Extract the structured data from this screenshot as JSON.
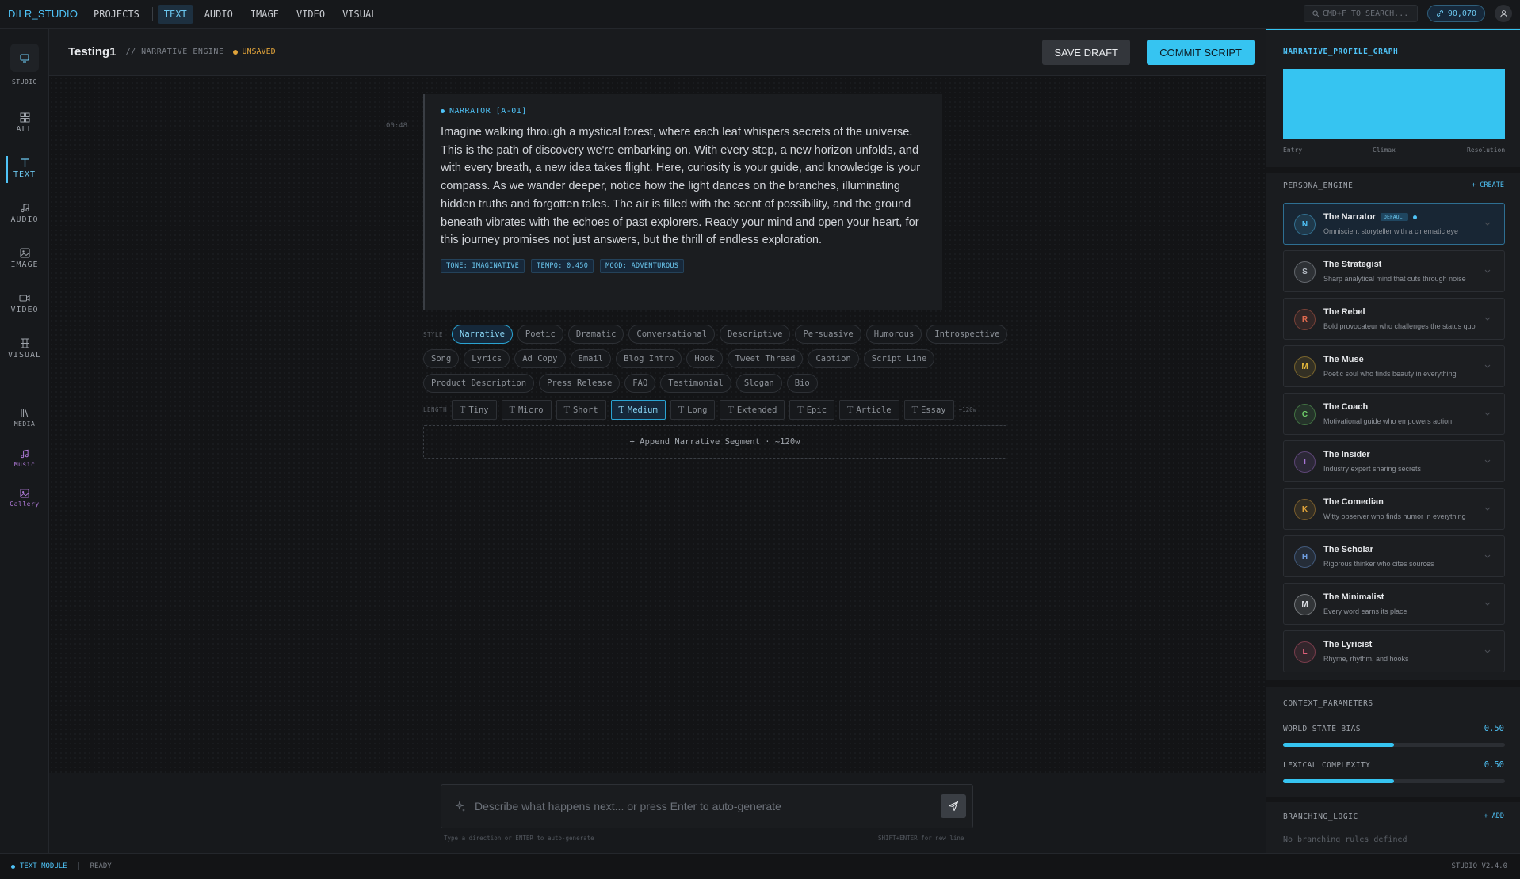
{
  "topbar": {
    "brand": "DILR_STUDIO",
    "nav": [
      "PROJECTS",
      "TEXT",
      "AUDIO",
      "IMAGE",
      "VIDEO",
      "VISUAL"
    ],
    "active_nav": "TEXT",
    "search_placeholder": "CMD+F TO SEARCH...",
    "credits": "90,070"
  },
  "rail": {
    "studio": "STUDIO",
    "all": "ALL",
    "text": "TEXT",
    "audio": "AUDIO",
    "image": "IMAGE",
    "video": "VIDEO",
    "visual": "VISUAL",
    "media": "MEDIA",
    "music": "Music",
    "gallery": "Gallery"
  },
  "header": {
    "title": "Testing1",
    "subtitle": "// NARRATIVE ENGINE",
    "status": "UNSAVED",
    "save_draft": "SAVE DRAFT",
    "commit": "COMMIT SCRIPT"
  },
  "segment": {
    "timestamp": "00:48",
    "speaker": "NARRATOR [A-01]",
    "text": "Imagine walking through a mystical forest, where each leaf whispers secrets of the universe. This is the path of discovery we're embarking on. With every step, a new horizon unfolds, and with every breath, a new idea takes flight. Here, curiosity is your guide, and knowledge is your compass. As we wander deeper, notice how the light dances on the branches, illuminating hidden truths and forgotten tales. The air is filled with the scent of possibility, and the ground beneath vibrates with the echoes of past explorers. Ready your mind and open your heart, for this journey promises not just answers, but the thrill of endless exploration.",
    "tags": [
      "TONE: IMAGINATIVE",
      "TEMPO: 0.450",
      "MOOD: ADVENTUROUS"
    ]
  },
  "style": {
    "label": "STYLE",
    "row1": [
      "Narrative",
      "Poetic",
      "Dramatic",
      "Conversational",
      "Descriptive",
      "Persuasive",
      "Humorous",
      "Introspective"
    ],
    "row2": [
      "Song",
      "Lyrics",
      "Ad Copy",
      "Email",
      "Blog Intro",
      "Hook",
      "Tweet Thread",
      "Caption",
      "Script Line"
    ],
    "row3": [
      "Product Description",
      "Press Release",
      "FAQ",
      "Testimonial",
      "Slogan",
      "Bio"
    ],
    "selected": "Narrative"
  },
  "length": {
    "label": "LENGTH",
    "options": [
      "Tiny",
      "Micro",
      "Short",
      "Medium",
      "Long",
      "Extended",
      "Epic",
      "Article",
      "Essay"
    ],
    "selected": "Medium",
    "hint": "~120w"
  },
  "append_label": "+ Append Narrative Segment · ~120w",
  "prompt": {
    "placeholder": "Describe what happens next... or press Enter to auto-generate",
    "hint_left": "Type a direction or ENTER to auto-generate",
    "hint_right": "SHIFT+ENTER for new line"
  },
  "status": {
    "module": "TEXT MODULE",
    "state": "READY",
    "version": "STUDIO V2.4.0"
  },
  "right_panel": {
    "graph_title": "NARRATIVE_PROFILE_GRAPH",
    "graph_labels": [
      "Entry",
      "Climax",
      "Resolution"
    ],
    "persona_title": "PERSONA_ENGINE",
    "create": "+ CREATE",
    "personas": [
      {
        "initial": "N",
        "name": "The Narrator",
        "desc": "Omniscient storyteller with a cinematic eye",
        "badge": "DEFAULT",
        "color": "#4fc3f7"
      },
      {
        "initial": "S",
        "name": "The Strategist",
        "desc": "Sharp analytical mind that cuts through noise",
        "color": "#b5bbc3"
      },
      {
        "initial": "R",
        "name": "The Rebel",
        "desc": "Bold provocateur who challenges the status quo",
        "color": "#e06a4f"
      },
      {
        "initial": "M",
        "name": "The Muse",
        "desc": "Poetic soul who finds beauty in everything",
        "color": "#e0b53a"
      },
      {
        "initial": "C",
        "name": "The Coach",
        "desc": "Motivational guide who empowers action",
        "color": "#6fcf6a"
      },
      {
        "initial": "I",
        "name": "The Insider",
        "desc": "Industry expert sharing secrets",
        "color": "#a874d6"
      },
      {
        "initial": "K",
        "name": "The Comedian",
        "desc": "Witty observer who finds humor in everything",
        "color": "#e0a33a"
      },
      {
        "initial": "H",
        "name": "The Scholar",
        "desc": "Rigorous thinker who cites sources",
        "color": "#6f9ee0"
      },
      {
        "initial": "M",
        "name": "The Minimalist",
        "desc": "Every word earns its place",
        "color": "#d8dbe0"
      },
      {
        "initial": "L",
        "name": "The Lyricist",
        "desc": "Rhyme, rhythm, and hooks",
        "color": "#e0607a"
      }
    ],
    "context_title": "CONTEXT_PARAMETERS",
    "params": [
      {
        "label": "WORLD STATE BIAS",
        "value": "0.50",
        "fraction": 0.5
      },
      {
        "label": "LEXICAL COMPLEXITY",
        "value": "0.50",
        "fraction": 0.5
      }
    ],
    "branch_title": "BRANCHING_LOGIC",
    "add": "+ ADD",
    "branch_empty": "No branching rules defined"
  },
  "colors": {
    "accent": "#36c4f1",
    "warning": "#e0a33a",
    "background": "#16181b"
  }
}
